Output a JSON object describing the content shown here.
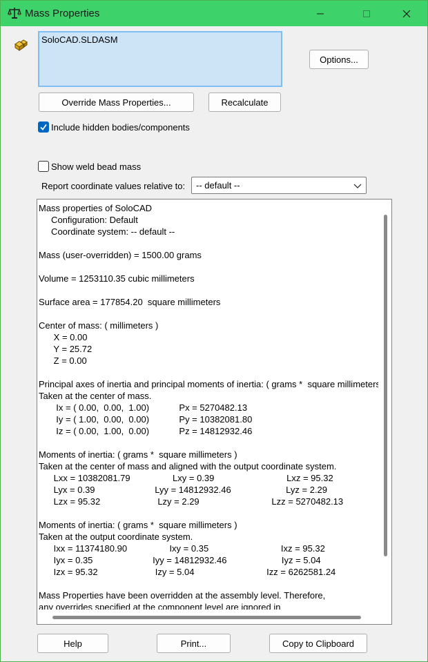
{
  "window": {
    "title": "Mass Properties",
    "icon": "scales-icon"
  },
  "selection": {
    "items": [
      "SoloCAD.SLDASM"
    ]
  },
  "buttons": {
    "options": "Options...",
    "override": "Override Mass Properties...",
    "recalculate": "Recalculate",
    "help": "Help",
    "print": "Print...",
    "copy": "Copy to Clipboard"
  },
  "options": {
    "include_hidden_label": "Include hidden bodies/components",
    "include_hidden_checked": true,
    "weld_bead_label": "Show weld bead mass",
    "weld_bead_checked": false,
    "coord_label": "Report coordinate values relative to:",
    "coord_value": "-- default --"
  },
  "report": {
    "lines": [
      "Mass properties of SoloCAD",
      "     Configuration: Default",
      "     Coordinate system: -- default --",
      "",
      "Mass (user-overridden) = 1500.00 grams",
      "",
      "Volume = 1253110.35 cubic millimeters",
      "",
      "Surface area = 177854.20  square millimeters",
      "",
      "Center of mass: ( millimeters )",
      "      X = 0.00",
      "      Y = 25.72",
      "      Z = 0.00",
      "",
      "Principal axes of inertia and principal moments of inertia: ( grams *  square millimeters )",
      "Taken at the center of mass.",
      "       Ix = ( 0.00,  0.00,  1.00)            Px = 5270482.13",
      "       Iy = ( 1.00,  0.00,  0.00)            Py = 10382081.80",
      "       Iz = ( 0.00,  1.00,  0.00)            Pz = 14812932.46",
      "",
      "Moments of inertia: ( grams *  square millimeters )",
      "Taken at the center of mass and aligned with the output coordinate system.",
      "      Lxx = 10382081.79                 Lxy = 0.39                             Lxz = 95.32",
      "      Lyx = 0.39                        Lyy = 14812932.46                      Lyz = 2.29",
      "      Lzx = 95.32                       Lzy = 2.29                             Lzz = 5270482.13",
      "",
      "Moments of inertia: ( grams *  square millimeters )",
      "Taken at the output coordinate system.",
      "      Ixx = 11374180.90                 Ixy = 0.35                             Ixz = 95.32",
      "      Iyx = 0.35                        Iyy = 14812932.46                      Iyz = 5.04",
      "      Izx = 95.32                       Izy = 5.04                             Izz = 6262581.24",
      "",
      "Mass Properties have been overridden at the assembly level. Therefore,",
      "any overrides specified at the component level are ignored in"
    ]
  },
  "colors": {
    "titlebar": "#3ed26a",
    "selection_bg": "#cde4f7",
    "checkbox_accent": "#0067c0"
  }
}
